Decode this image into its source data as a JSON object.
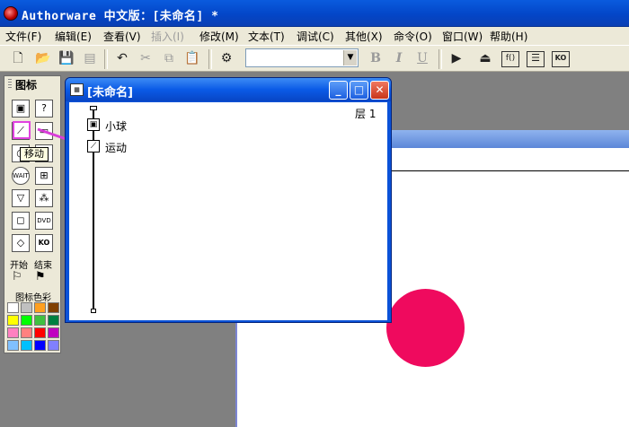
{
  "titlebar": {
    "title": "Authorware 中文版：[未命名] *"
  },
  "menubar": {
    "items": [
      {
        "label": "文件(F)",
        "enabled": true
      },
      {
        "label": "编辑(E)",
        "enabled": true
      },
      {
        "label": "查看(V)",
        "enabled": true
      },
      {
        "label": "插入(I)",
        "enabled": false
      },
      {
        "label": "修改(M)",
        "enabled": true
      },
      {
        "label": "文本(T)",
        "enabled": true
      },
      {
        "label": "调试(C)",
        "enabled": true
      },
      {
        "label": "其他(X)",
        "enabled": true
      },
      {
        "label": "命令(O)",
        "enabled": true
      },
      {
        "label": "窗口(W)",
        "enabled": true
      },
      {
        "label": "帮助(H)",
        "enabled": true
      }
    ]
  },
  "toolbar": {
    "icons": [
      "new-icon",
      "open-icon",
      "save-all-icon",
      "import-icon",
      "undo-icon",
      "cut-icon",
      "copy-icon",
      "paste-icon",
      "find-icon"
    ],
    "font_combo_value": "",
    "format_buttons": [
      "B",
      "I",
      "U"
    ],
    "right_icons": [
      "run-icon",
      "control-panel-icon",
      "functions-icon",
      "variables-icon",
      "knowledge-objects-icon"
    ]
  },
  "palette": {
    "title": "图标",
    "start_label": "开始",
    "end_label": "结束",
    "colors_label": "图标色彩",
    "tooltip": "移动",
    "swatch_colors": [
      "#ffffff",
      "#c0c0c0",
      "#ffa020",
      "#804000",
      "#ffff00",
      "#00ff00",
      "#40c040",
      "#008040",
      "#ff80c0",
      "#ff8080",
      "#ff0000",
      "#c000c0",
      "#80c0ff",
      "#00c0ff",
      "#0000ff",
      "#8080ff"
    ]
  },
  "flow_window": {
    "title": "[未命名]",
    "level": "层 1",
    "items": [
      {
        "label": "小球",
        "icon": "display-icon"
      },
      {
        "label": "运动",
        "icon": "motion-icon"
      }
    ]
  },
  "presentation": {
    "ball_color": "#ef0a5e"
  }
}
